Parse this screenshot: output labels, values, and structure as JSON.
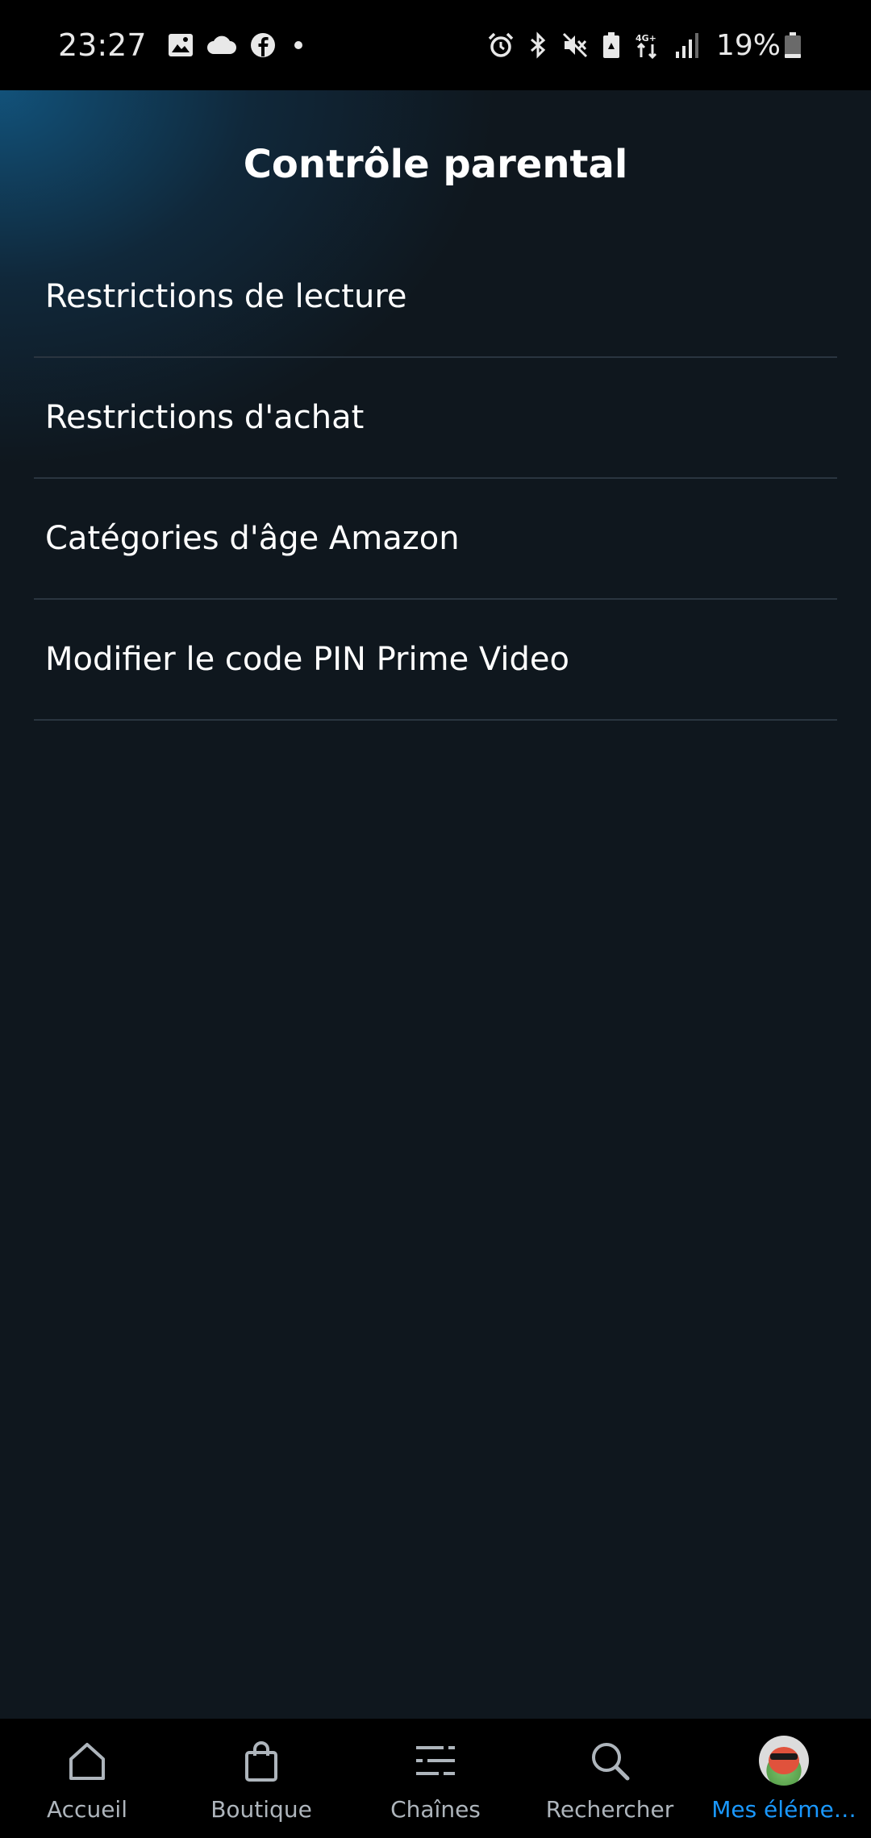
{
  "status_bar": {
    "time": "23:27",
    "left_icons": [
      "gallery-icon",
      "cloud-icon",
      "facebook-icon",
      "dot-icon"
    ],
    "right_icons": [
      "alarm-icon",
      "bluetooth-icon",
      "mute-icon",
      "battery-saver-icon",
      "network-4g-icon",
      "signal-icon"
    ],
    "network_label": "4G+",
    "battery_percent": "19%",
    "battery_level": 0.19
  },
  "page": {
    "title": "Contrôle parental"
  },
  "menu": {
    "items": [
      {
        "label": "Restrictions de lecture"
      },
      {
        "label": "Restrictions d'achat"
      },
      {
        "label": "Catégories d'âge Amazon"
      },
      {
        "label": "Modifier le code PIN Prime Video"
      }
    ]
  },
  "bottom_nav": {
    "items": [
      {
        "label": "Accueil",
        "icon": "home-icon",
        "active": false
      },
      {
        "label": "Boutique",
        "icon": "shopping-bag-icon",
        "active": false
      },
      {
        "label": "Chaînes",
        "icon": "channels-icon",
        "active": false
      },
      {
        "label": "Rechercher",
        "icon": "search-icon",
        "active": false
      },
      {
        "label": "Mes éléme…",
        "icon": "profile-avatar",
        "active": true
      }
    ]
  },
  "colors": {
    "background": "#0f171e",
    "accent": "#1a98ff",
    "divider": "#2a3540",
    "nav_label": "#aeb5bc"
  }
}
